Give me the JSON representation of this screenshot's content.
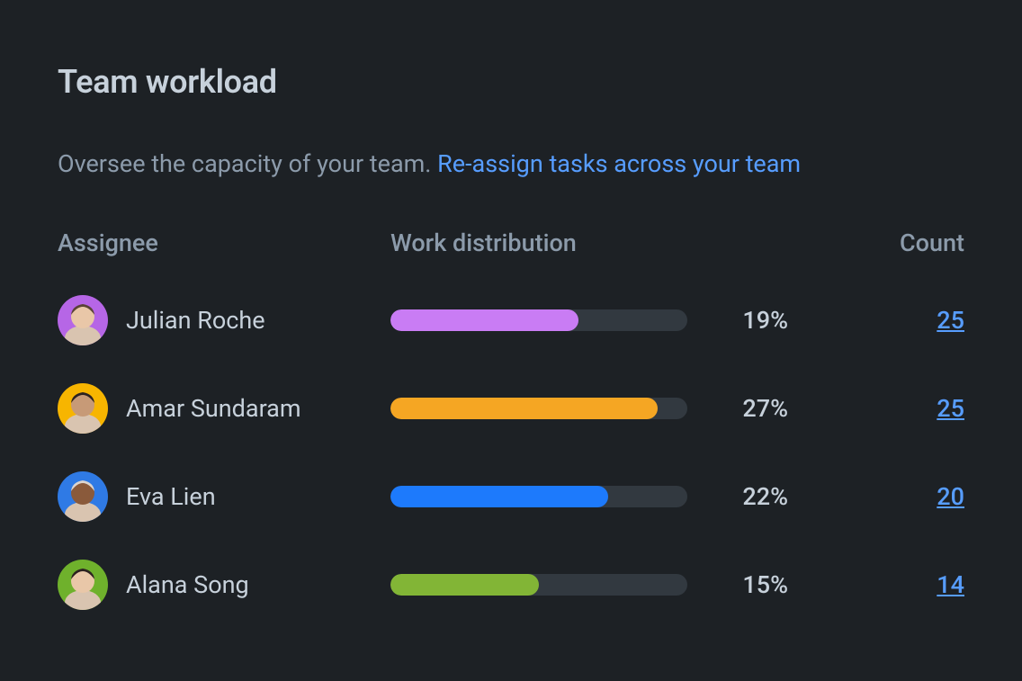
{
  "header": {
    "title": "Team workload",
    "subtitle_text": "Oversee the capacity of your team. ",
    "subtitle_link": "Re-assign tasks across your team"
  },
  "columns": {
    "assignee": "Assignee",
    "work": "Work distribution",
    "count": "Count"
  },
  "bar_max_pct": 30,
  "rows": [
    {
      "name": "Julian Roche",
      "pct": 19,
      "pct_label": "19%",
      "count": 25,
      "color": "#c97cf4",
      "avatar_bg": "#b666e6"
    },
    {
      "name": "Amar Sundaram",
      "pct": 27,
      "pct_label": "27%",
      "count": 25,
      "color": "#f5a623",
      "avatar_bg": "#f7b500"
    },
    {
      "name": "Eva Lien",
      "pct": 22,
      "pct_label": "22%",
      "count": 20,
      "color": "#1d7afc",
      "avatar_bg": "#2f7ae5"
    },
    {
      "name": "Alana Song",
      "pct": 15,
      "pct_label": "15%",
      "count": 14,
      "color": "#82b536",
      "avatar_bg": "#6fb12c"
    }
  ],
  "chart_data": {
    "type": "bar",
    "title": "Team workload — Work distribution",
    "xlabel": "Assignee",
    "ylabel": "Work distribution (%)",
    "ylim": [
      0,
      30
    ],
    "categories": [
      "Julian Roche",
      "Amar Sundaram",
      "Eva Lien",
      "Alana Song"
    ],
    "series": [
      {
        "name": "Work distribution (%)",
        "values": [
          19,
          27,
          22,
          15
        ]
      },
      {
        "name": "Count",
        "values": [
          25,
          25,
          20,
          14
        ]
      }
    ]
  }
}
